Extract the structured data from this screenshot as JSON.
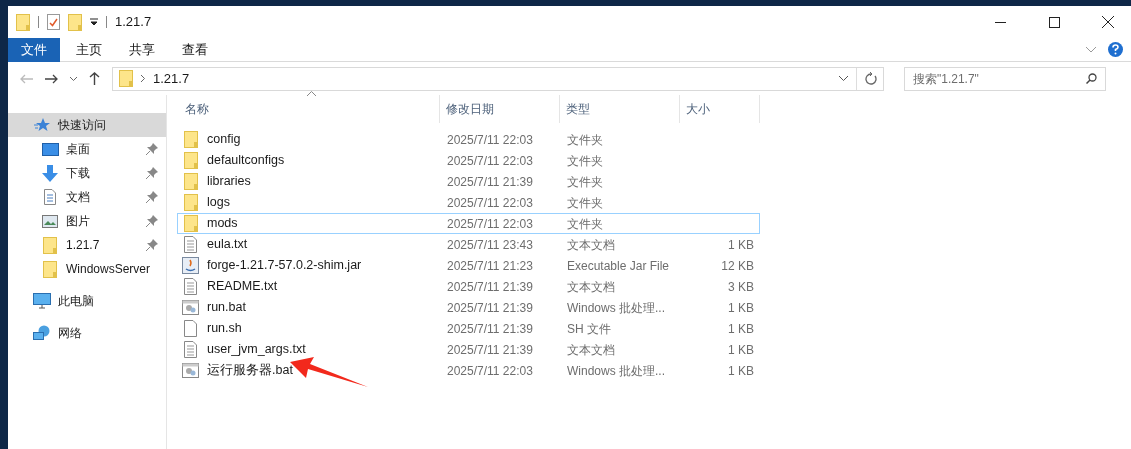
{
  "window": {
    "title": "1.21.7"
  },
  "ribbon_tabs": [
    {
      "label": "文件",
      "selected": true
    },
    {
      "label": "主页",
      "selected": false
    },
    {
      "label": "共享",
      "selected": false
    },
    {
      "label": "查看",
      "selected": false
    }
  ],
  "address": {
    "path": "1.21.7"
  },
  "search": {
    "placeholder": "搜索\"1.21.7\""
  },
  "sidebar": {
    "items": [
      {
        "label": "快速访问",
        "kind": "quick",
        "selected": true,
        "pinned": false,
        "children": [
          {
            "label": "桌面",
            "kind": "desktop",
            "selected": false,
            "pinned": true
          },
          {
            "label": "下载",
            "kind": "download",
            "selected": false,
            "pinned": true
          },
          {
            "label": "文档",
            "kind": "document",
            "selected": false,
            "pinned": true
          },
          {
            "label": "图片",
            "kind": "pictures",
            "selected": false,
            "pinned": true
          },
          {
            "label": "1.21.7",
            "kind": "folder",
            "selected": false,
            "pinned": true
          },
          {
            "label": "WindowsServer",
            "kind": "folder",
            "selected": false,
            "pinned": false
          }
        ]
      },
      {
        "label": "此电脑",
        "kind": "pc",
        "selected": false,
        "pinned": false
      },
      {
        "label": "网络",
        "kind": "network",
        "selected": false,
        "pinned": false
      }
    ]
  },
  "table": {
    "columns": [
      "名称",
      "修改日期",
      "类型",
      "大小"
    ],
    "rows": [
      {
        "name": "config",
        "date": "2025/7/11 22:03",
        "type": "文件夹",
        "kind": "folder",
        "focused": false
      },
      {
        "name": "defaultconfigs",
        "date": "2025/7/11 22:03",
        "type": "文件夹",
        "kind": "folder",
        "focused": false
      },
      {
        "name": "libraries",
        "date": "2025/7/11 21:39",
        "type": "文件夹",
        "kind": "folder",
        "focused": false
      },
      {
        "name": "logs",
        "date": "2025/7/11 22:03",
        "type": "文件夹",
        "kind": "folder",
        "focused": false
      },
      {
        "name": "mods",
        "date": "2025/7/11 22:03",
        "type": "文件夹",
        "kind": "folder",
        "focused": true
      },
      {
        "name": "eula.txt",
        "date": "2025/7/11 23:43",
        "type": "文本文档",
        "size": "1 KB",
        "kind": "text",
        "focused": false
      },
      {
        "name": "forge-1.21.7-57.0.2-shim.jar",
        "date": "2025/7/11 21:23",
        "type": "Executable Jar File",
        "size": "12 KB",
        "kind": "jar",
        "focused": false
      },
      {
        "name": "README.txt",
        "date": "2025/7/11 21:39",
        "type": "文本文档",
        "size": "3 KB",
        "kind": "text",
        "focused": false
      },
      {
        "name": "run.bat",
        "date": "2025/7/11 21:39",
        "type": "Windows 批处理...",
        "size": "1 KB",
        "kind": "bat",
        "focused": false
      },
      {
        "name": "run.sh",
        "date": "2025/7/11 21:39",
        "type": "SH 文件",
        "size": "1 KB",
        "kind": "file",
        "focused": false
      },
      {
        "name": "user_jvm_args.txt",
        "date": "2025/7/11 21:39",
        "type": "文本文档",
        "size": "1 KB",
        "kind": "text",
        "focused": false
      },
      {
        "name": "运行服务器.bat",
        "date": "2025/7/11 22:03",
        "type": "Windows 批处理...",
        "size": "1 KB",
        "kind": "bat",
        "focused": false
      }
    ]
  }
}
